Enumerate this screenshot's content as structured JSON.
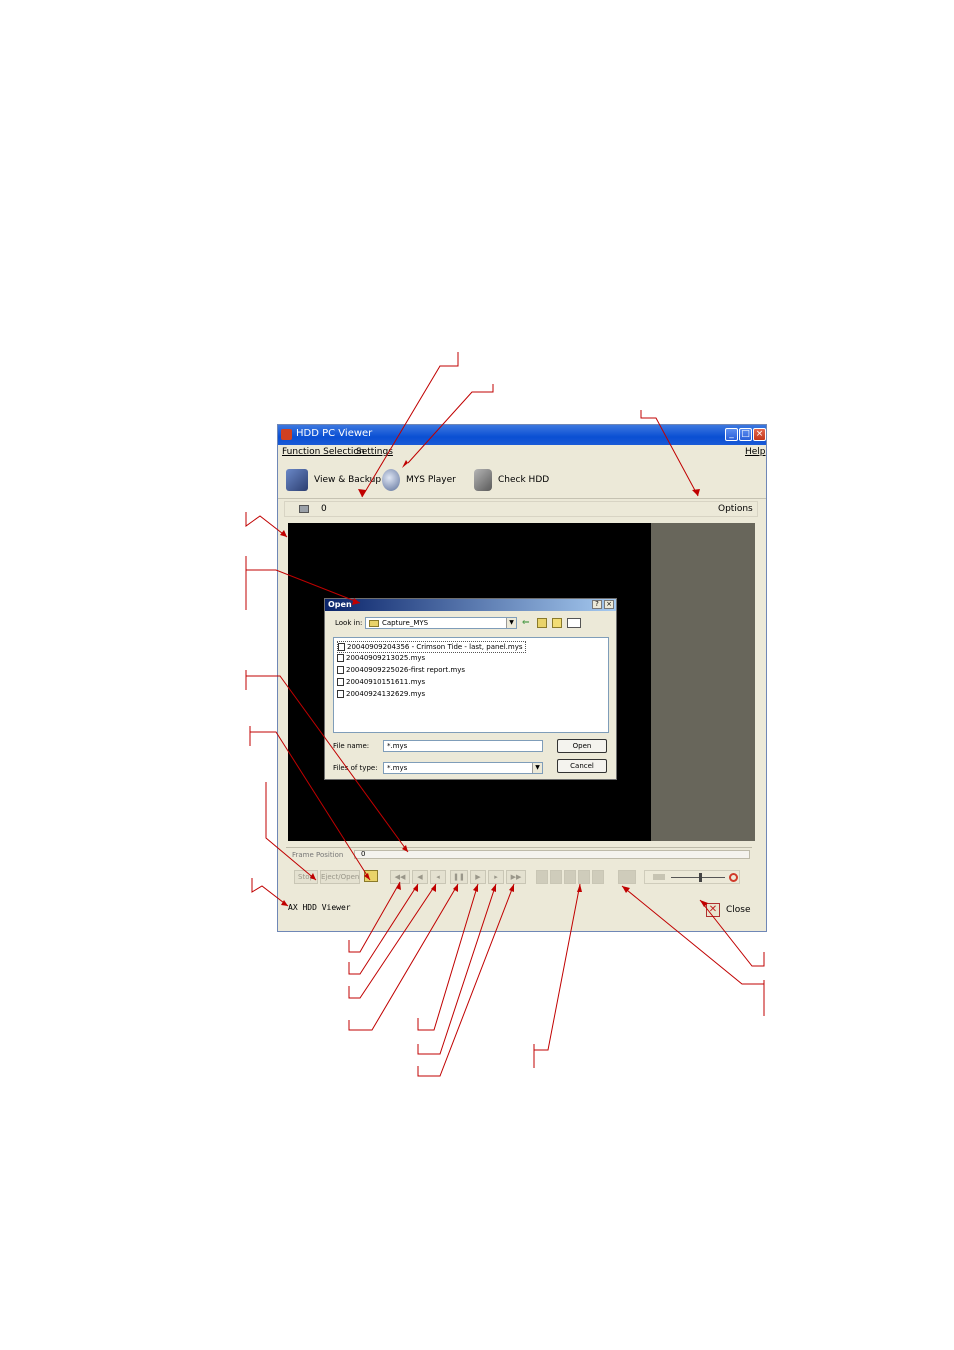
{
  "window": {
    "title": "HDD PC Viewer",
    "menu": [
      "Function Selection",
      "Settings"
    ],
    "help": "Help"
  },
  "toolbar": {
    "tools": [
      {
        "label": "View & Backup",
        "icon": "monitor-backup-icon"
      },
      {
        "label": "MYS Player",
        "icon": "player-icon"
      },
      {
        "label": "Check HDD",
        "icon": "hdd-check-icon"
      }
    ]
  },
  "subbar": {
    "count": "0",
    "options": "Options"
  },
  "playback": {
    "frame_position_label": "Frame Position",
    "frame_value": "0",
    "left_buttons": [
      "Stop",
      "Eject/Open"
    ]
  },
  "status": {
    "app_label": "AX HDD Viewer",
    "close": "Close"
  },
  "dialog": {
    "title": "Open",
    "look_in_label": "Look in:",
    "look_in_value": "Capture_MYS",
    "files": [
      "20040909204356 - Crimson Tide - last, panel.mys",
      "20040909213025.mys",
      "20040909225026-first report.mys",
      "20040910151611.mys",
      "20040924132629.mys"
    ],
    "file_name_label": "File name:",
    "file_name_value": "*.mys",
    "file_type_label": "Files of type:",
    "file_type_value": "*.mys",
    "open_button": "Open",
    "cancel_button": "Cancel",
    "help_button": "?",
    "close_button": "×"
  },
  "colors": {
    "title_blue": "#0a4fd3",
    "callout_red": "#c00000",
    "side_panel": "#68665b"
  }
}
